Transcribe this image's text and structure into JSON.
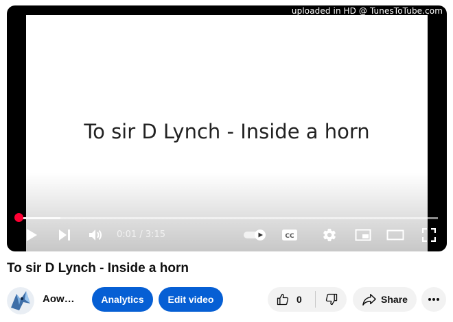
{
  "player": {
    "watermark": "uploaded in HD @ TunesToTube.com",
    "overlay_title": "To sir D Lynch - Inside a horn",
    "time_current": "0:01",
    "time_separator": " / ",
    "time_total": "3:15",
    "progress_fraction": 0.005,
    "buffered_fraction": 0.1,
    "autoplay": true,
    "icons": [
      "play-icon",
      "next-icon",
      "volume-icon",
      "autoplay-toggle",
      "captions-icon",
      "settings-icon",
      "miniplayer-icon",
      "theater-icon",
      "fullscreen-icon"
    ]
  },
  "video": {
    "title": "To sir D Lynch - Inside a horn"
  },
  "channel": {
    "name": "Aow…"
  },
  "actions": {
    "analytics_label": "Analytics",
    "edit_label": "Edit video",
    "like_count": "0",
    "share_label": "Share"
  },
  "colors": {
    "accent_blue": "#065fd4",
    "progress_red": "#ff0033",
    "pill_gray": "#f2f2f2"
  }
}
